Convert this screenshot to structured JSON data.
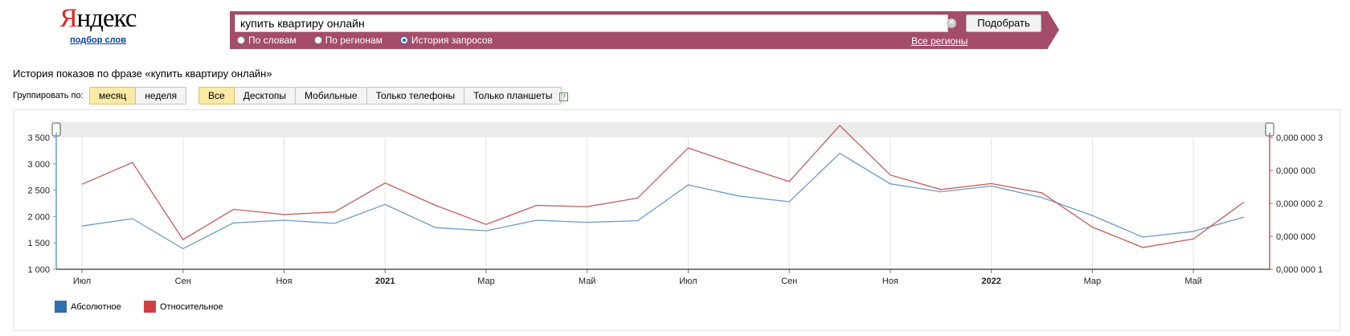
{
  "logo": {
    "first_letter": "Я",
    "rest": "ндекс",
    "subtitle": "подбор слов"
  },
  "search": {
    "query": "купить квартиру онлайн",
    "button": "Подобрать",
    "regions_link": "Все регионы"
  },
  "modes": [
    {
      "label": "По словам",
      "selected": false
    },
    {
      "label": "По регионам",
      "selected": false
    },
    {
      "label": "История запросов",
      "selected": true
    }
  ],
  "history_title": "История показов по фразе «купить квартиру онлайн»",
  "group_by": {
    "label": "Группировать по:",
    "options": [
      {
        "label": "месяц",
        "selected": true
      },
      {
        "label": "неделя",
        "selected": false
      }
    ]
  },
  "devices": [
    {
      "label": "Все",
      "selected": true
    },
    {
      "label": "Десктопы",
      "selected": false
    },
    {
      "label": "Мобильные",
      "selected": false
    },
    {
      "label": "Только телефоны",
      "selected": false
    },
    {
      "label": "Только планшеты",
      "selected": false
    }
  ],
  "help_glyph": "?",
  "colors": {
    "brand_bar": "#a44c6a",
    "absolute": "#6b9bc7",
    "relative": "#c65a5a",
    "legend_absolute": "#2e6fb0",
    "legend_relative": "#cf4141"
  },
  "chart_data": {
    "type": "line",
    "x": [
      "2020-07",
      "2020-08",
      "2020-09",
      "2020-10",
      "2020-11",
      "2020-12",
      "2021-01",
      "2021-02",
      "2021-03",
      "2021-04",
      "2021-05",
      "2021-06",
      "2021-07",
      "2021-08",
      "2021-09",
      "2021-10",
      "2021-11",
      "2021-12",
      "2022-01",
      "2022-02",
      "2022-03",
      "2022-04",
      "2022-05",
      "2022-06"
    ],
    "x_tick_labels": [
      {
        "at": "2020-07",
        "label": "Июл",
        "bold": false
      },
      {
        "at": "2020-09",
        "label": "Сен",
        "bold": false
      },
      {
        "at": "2020-11",
        "label": "Ноя",
        "bold": false
      },
      {
        "at": "2021-01",
        "label": "2021",
        "bold": true
      },
      {
        "at": "2021-03",
        "label": "Мар",
        "bold": false
      },
      {
        "at": "2021-05",
        "label": "Май",
        "bold": false
      },
      {
        "at": "2021-07",
        "label": "Июл",
        "bold": false
      },
      {
        "at": "2021-09",
        "label": "Сен",
        "bold": false
      },
      {
        "at": "2021-11",
        "label": "Ноя",
        "bold": false
      },
      {
        "at": "2022-01",
        "label": "2022",
        "bold": true
      },
      {
        "at": "2022-03",
        "label": "Мар",
        "bold": false
      },
      {
        "at": "2022-05",
        "label": "Май",
        "bold": false
      }
    ],
    "y_left": {
      "range": [
        1000,
        3500
      ],
      "ticks": [
        1000,
        1500,
        2000,
        2500,
        3000,
        3500
      ],
      "tick_labels": [
        "1 000",
        "1 500",
        "2 000",
        "2 500",
        "3 000",
        "3 500"
      ]
    },
    "y_right": {
      "range": [
        1e-07,
        3e-07
      ],
      "ticks": [
        1e-07,
        1.5e-07,
        2e-07,
        2.5e-07,
        3e-07
      ],
      "tick_labels": [
        "0,000 000 1",
        "0,000 000",
        "0,000 000 2",
        "0,000 000",
        "0,000 000 3"
      ]
    },
    "grid": true,
    "legend_position": "bottom-left",
    "series": [
      {
        "name": "Абсолютное",
        "axis": "left",
        "values": [
          1820,
          1960,
          1390,
          1880,
          1930,
          1870,
          2230,
          1790,
          1730,
          1930,
          1890,
          1920,
          2600,
          2390,
          2280,
          3200,
          2620,
          2470,
          2580,
          2360,
          2020,
          1610,
          1720,
          1990
        ]
      },
      {
        "name": "Относительное",
        "axis": "right",
        "values": [
          2.29e-07,
          2.62e-07,
          1.45e-07,
          1.91e-07,
          1.83e-07,
          1.87e-07,
          2.31e-07,
          1.97e-07,
          1.68e-07,
          1.97e-07,
          1.95e-07,
          2.08e-07,
          2.84e-07,
          2.58e-07,
          2.33e-07,
          3.18e-07,
          2.43e-07,
          2.21e-07,
          2.3e-07,
          2.16e-07,
          1.64e-07,
          1.33e-07,
          1.46e-07,
          2.02e-07
        ]
      }
    ]
  }
}
